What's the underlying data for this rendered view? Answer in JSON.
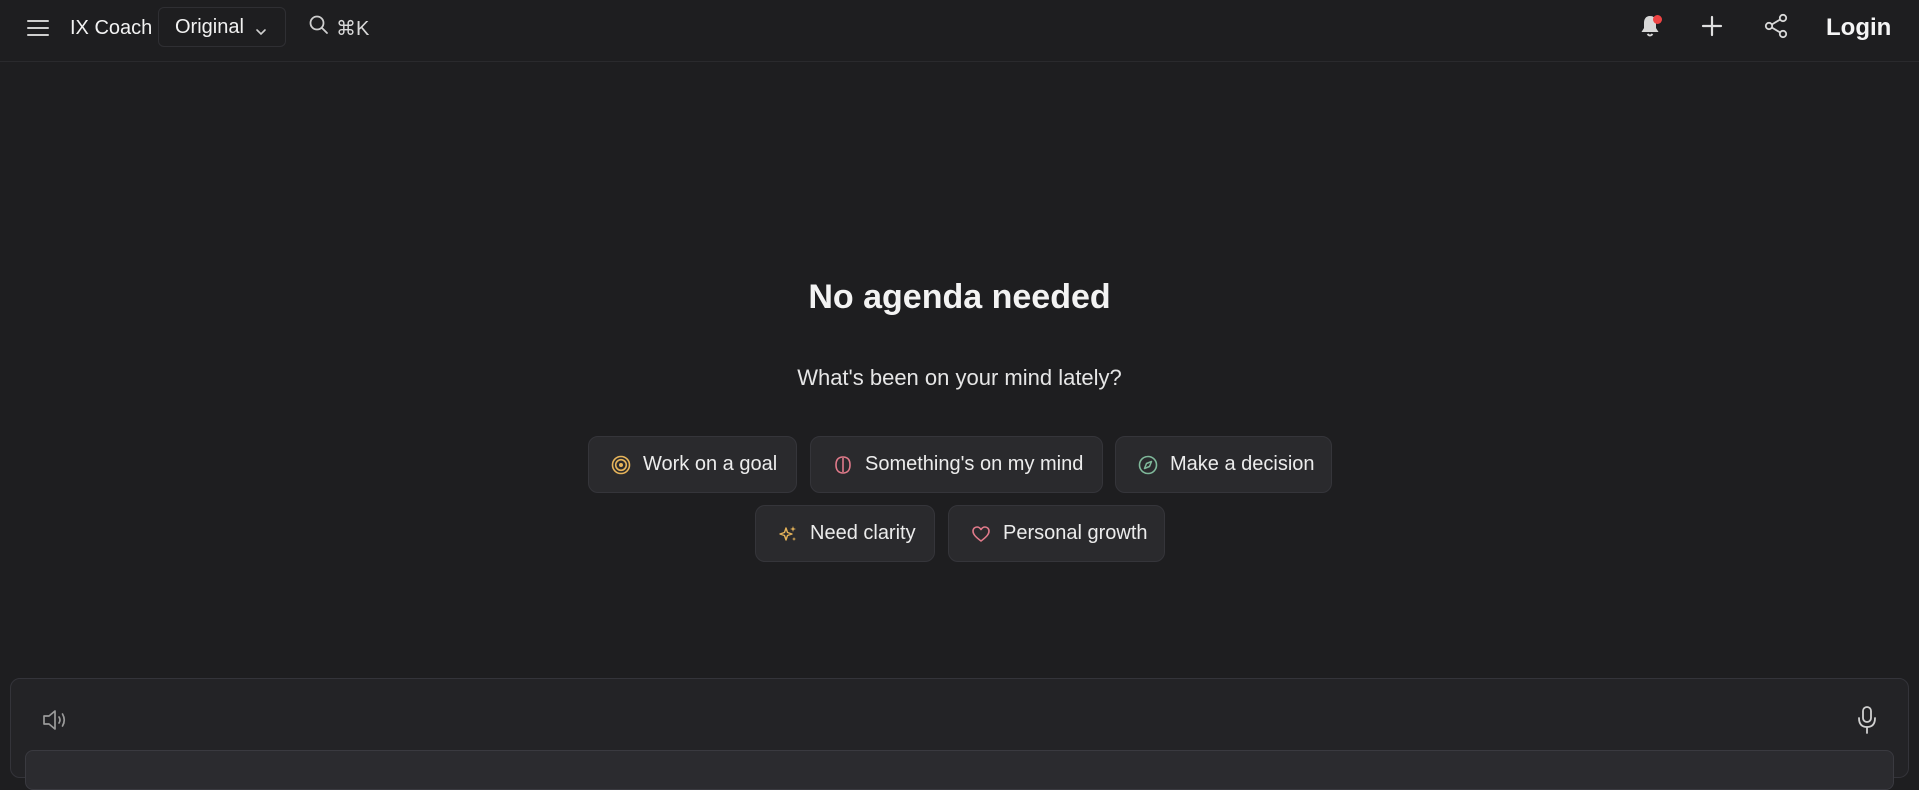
{
  "header": {
    "brand": "IX Coach",
    "model_select": "Original",
    "search_shortcut": "⌘K",
    "login_label": "Login"
  },
  "main": {
    "title": "No agenda needed",
    "subtitle": "What's been on your mind lately?",
    "chips": [
      {
        "label": "Work on a goal",
        "icon": "target-icon",
        "color": "#e6b45a"
      },
      {
        "label": "Something's on my mind",
        "icon": "brain-icon",
        "color": "#e07a8a"
      },
      {
        "label": "Make a decision",
        "icon": "compass-icon",
        "color": "#7fb89a"
      },
      {
        "label": "Need clarity",
        "icon": "sparkles-icon",
        "color": "#e6b45a"
      },
      {
        "label": "Personal growth",
        "icon": "heart-icon",
        "color": "#e07a8a"
      }
    ]
  },
  "composer": {
    "speaker_icon": "speaker-icon",
    "mic_icon": "microphone-icon"
  },
  "colors": {
    "background": "#1e1e20",
    "notification_dot": "#ef4444"
  }
}
